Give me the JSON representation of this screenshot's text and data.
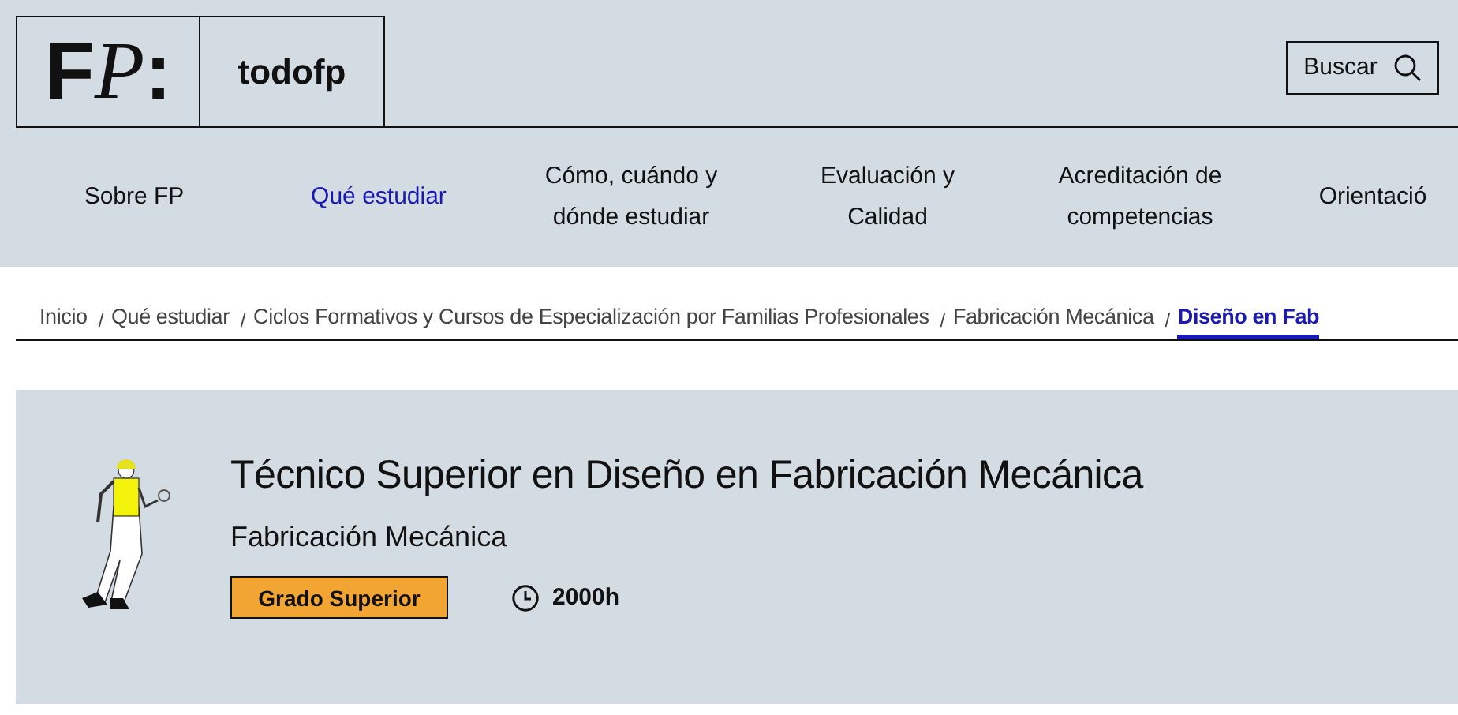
{
  "logo": {
    "glyphs": [
      "F",
      "P",
      ":"
    ],
    "name": "todofp"
  },
  "search_button": {
    "label": "Buscar"
  },
  "nav": [
    {
      "label": "Sobre FP",
      "selected": false
    },
    {
      "label": "Qué estudiar",
      "selected": true
    },
    {
      "label": "Cómo, cuándo y dónde estudiar",
      "selected": false
    },
    {
      "label": "Evaluación y Calidad",
      "selected": false
    },
    {
      "label": "Acreditación de competencias",
      "selected": false
    },
    {
      "label": "Orientació",
      "selected": false
    }
  ],
  "breadcrumb": [
    {
      "label": "Inicio",
      "selected": false
    },
    {
      "separator": "/",
      "label": "Qué estudiar",
      "selected": false
    },
    {
      "separator": "/",
      "label": "Ciclos Formativos y Cursos de Especialización por Familias Profesionales",
      "selected": false
    },
    {
      "separator": "/",
      "label": "Fabricación Mecánica",
      "selected": false
    },
    {
      "separator": "/",
      "label": "Diseño en Fab",
      "selected": true
    }
  ],
  "course": {
    "title": "Técnico Superior en Diseño en Fabricación Mecánica",
    "family": "Fabricación Mecánica",
    "level_badge": "Grado Superior",
    "duration": "2000h"
  }
}
